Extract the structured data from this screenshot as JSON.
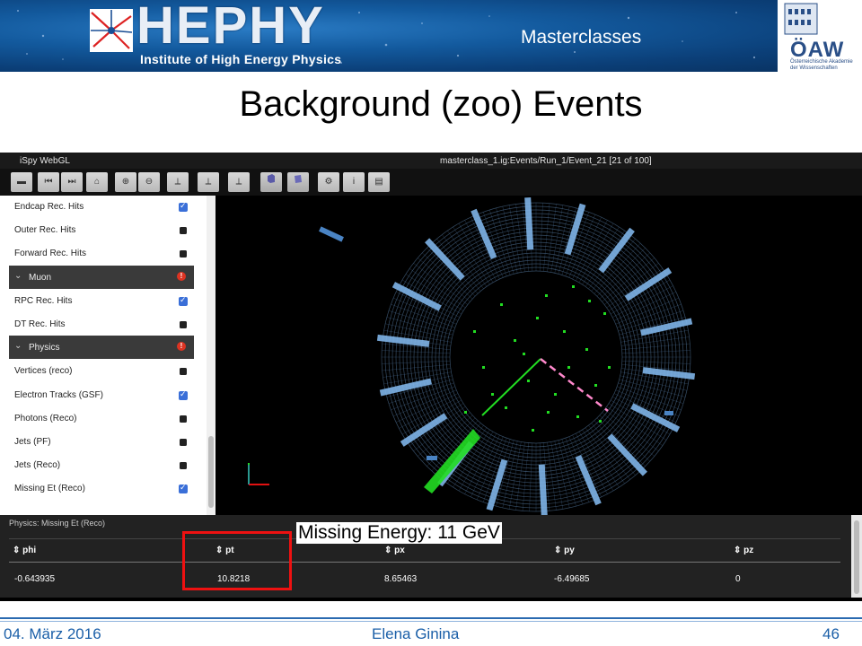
{
  "header": {
    "logo_word": "HEPHY",
    "logo_subtitle": "Institute of High Energy Physics",
    "section": "Masterclasses",
    "oaw_logo": "ÖAW",
    "oaw_subtitle": "Österreichische Akademie der Wissenschaften"
  },
  "slide": {
    "title": "Background (zoo) Events"
  },
  "app": {
    "name": "iSpy WebGL",
    "event_path": "masterclass_1.ig:Events/Run_1/Event_21 [21 of 100]",
    "toolbar_icons": [
      "open-folder-icon",
      "first-event-icon",
      "next-event-icon",
      "home-icon",
      "zoom-in-icon",
      "zoom-out-icon",
      "view-xyz-icon",
      "view-xz-icon",
      "view-yz-icon",
      "perspective-cube-icon",
      "orthographic-cube-icon",
      "settings-gear-icon",
      "info-icon",
      "export-image-icon"
    ]
  },
  "sidebar": {
    "items": [
      {
        "label": "Endcap Rec. Hits",
        "type": "item",
        "checked": true
      },
      {
        "label": "Outer Rec. Hits",
        "type": "item",
        "checked": false
      },
      {
        "label": "Forward Rec. Hits",
        "type": "item",
        "checked": false
      },
      {
        "label": "Muon",
        "type": "group"
      },
      {
        "label": "RPC Rec. Hits",
        "type": "item",
        "checked": true
      },
      {
        "label": "DT Rec. Hits",
        "type": "item",
        "checked": false
      },
      {
        "label": "Physics",
        "type": "group"
      },
      {
        "label": "Vertices (reco)",
        "type": "item",
        "checked": false
      },
      {
        "label": "Electron Tracks (GSF)",
        "type": "item",
        "checked": true
      },
      {
        "label": "Photons (Reco)",
        "type": "item",
        "checked": false
      },
      {
        "label": "Jets (PF)",
        "type": "item",
        "checked": false
      },
      {
        "label": "Jets (Reco)",
        "type": "item",
        "checked": false
      },
      {
        "label": "Missing Et (Reco)",
        "type": "item",
        "checked": true
      }
    ]
  },
  "panel": {
    "title": "Physics: Missing Et (Reco)",
    "columns": [
      "phi",
      "pt",
      "px",
      "py",
      "pz"
    ],
    "row": [
      "-0.643935",
      "10.8218",
      "8.65463",
      "-6.49685",
      "0"
    ]
  },
  "annotation": {
    "missing_energy": "Missing Energy: 11 GeV"
  },
  "footer": {
    "date": "04. März 2016",
    "author": "Elena Ginina",
    "page": "46"
  },
  "colors": {
    "accent_blue": "#1b5fa8",
    "highlight_red": "#e11111",
    "checked_blue": "#3a6fd8",
    "detector_blue": "#7fb4e8",
    "track_green": "#22dd22",
    "met_pink": "#ff88cc"
  }
}
